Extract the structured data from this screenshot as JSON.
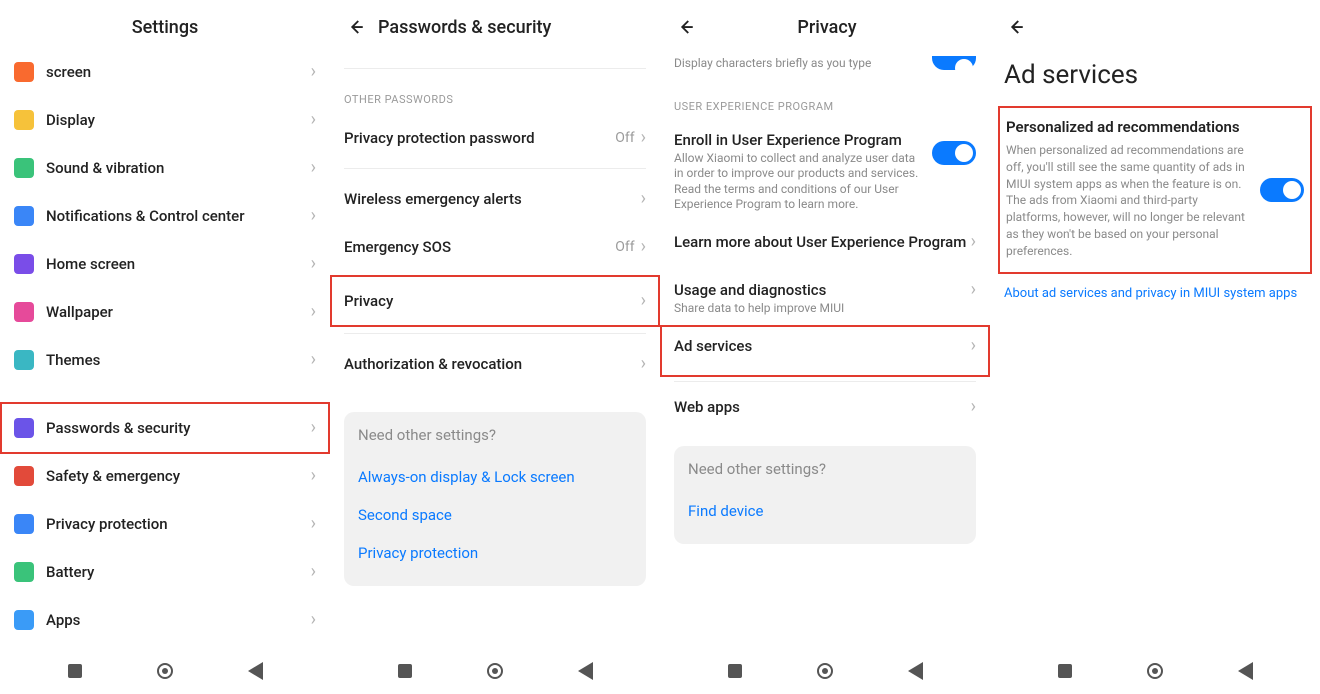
{
  "screen1": {
    "title": "Settings",
    "items": [
      {
        "label": "screen",
        "icon": "c-orange",
        "partial": true
      },
      {
        "label": "Display",
        "icon": "c-yellow"
      },
      {
        "label": "Sound & vibration",
        "icon": "c-green"
      },
      {
        "label": "Notifications & Control center",
        "icon": "c-blue"
      },
      {
        "label": "Home screen",
        "icon": "c-purple"
      },
      {
        "label": "Wallpaper",
        "icon": "c-pink"
      },
      {
        "label": "Themes",
        "icon": "c-teal"
      }
    ],
    "items2": [
      {
        "label": "Passwords & security",
        "icon": "c-fp",
        "highlight": true
      },
      {
        "label": "Safety & emergency",
        "icon": "c-red"
      },
      {
        "label": "Privacy protection",
        "icon": "c-shield"
      },
      {
        "label": "Battery",
        "icon": "c-bat"
      },
      {
        "label": "Apps",
        "icon": "c-gear"
      }
    ]
  },
  "screen2": {
    "title": "Passwords & security",
    "section": "OTHER PASSWORDS",
    "items": [
      {
        "label": "Privacy protection password",
        "value": "Off"
      },
      {
        "divider": true
      },
      {
        "label": "Wireless emergency alerts"
      },
      {
        "label": "Emergency SOS",
        "value": "Off"
      },
      {
        "label": "Privacy",
        "highlight": true
      },
      {
        "divider": true
      },
      {
        "label": "Authorization & revocation"
      }
    ],
    "card": {
      "title": "Need other settings?",
      "links": [
        "Always-on display & Lock screen",
        "Second space",
        "Privacy protection"
      ]
    }
  },
  "screen3": {
    "title": "Privacy",
    "top_sub": "Display characters briefly as you type",
    "section": "USER EXPERIENCE PROGRAM",
    "items": [
      {
        "label": "Enroll in User Experience Program",
        "sub": "Allow Xiaomi to collect and analyze user data in order to improve our products and services. Read the terms and conditions of our User Experience Program to learn more.",
        "toggle": true
      },
      {
        "label": "Learn more about User Experience Program"
      },
      {
        "label": "Usage and diagnostics",
        "sub": "Share data to help improve MIUI"
      },
      {
        "label": "Ad services",
        "highlight": true
      },
      {
        "divider": true
      },
      {
        "label": "Web apps"
      }
    ],
    "card": {
      "title": "Need other settings?",
      "links": [
        "Find device"
      ]
    }
  },
  "screen4": {
    "big_title": "Ad services",
    "ad": {
      "title": "Personalized ad recommendations",
      "desc": "When personalized ad recommendations are off, you'll still see the same quantity of ads in MIUI system apps as when the feature is on. The ads from Xiaomi and third-party platforms, however, will no longer be relevant as they won't be based on your personal preferences."
    },
    "link": "About ad services and privacy in MIUI system apps"
  }
}
